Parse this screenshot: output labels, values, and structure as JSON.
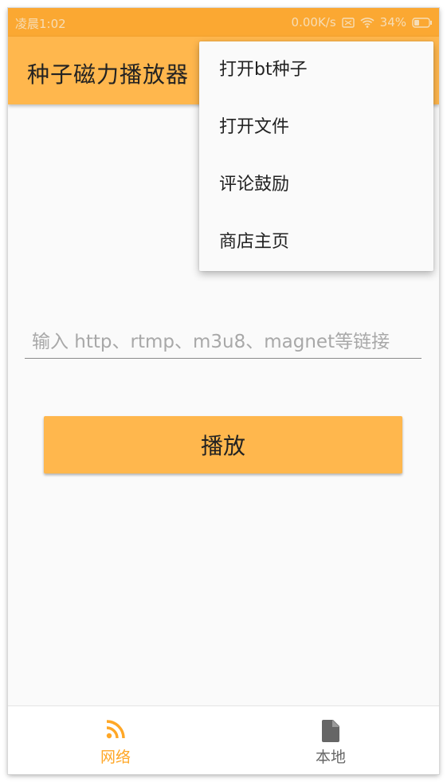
{
  "status_bar": {
    "time": "凌晨1:02",
    "net_speed": "0.00K/s",
    "battery": "34%",
    "icons": [
      "notification-icon",
      "wifi-icon",
      "battery-icon"
    ]
  },
  "app_bar": {
    "title": "种子磁力播放器"
  },
  "overflow_menu": {
    "items": [
      {
        "label": "打开bt种子"
      },
      {
        "label": "打开文件"
      },
      {
        "label": "评论鼓励"
      },
      {
        "label": "商店主页"
      }
    ]
  },
  "url_input": {
    "placeholder": "输入 http、rtmp、m3u8、magnet等链接",
    "value": ""
  },
  "play_button": {
    "label": "播放"
  },
  "bottom_nav": {
    "items": [
      {
        "label": "网络",
        "icon": "rss-icon",
        "active": true
      },
      {
        "label": "本地",
        "icon": "file-icon",
        "active": false
      }
    ]
  },
  "colors": {
    "status_bar": "#fba832",
    "accent": "#ffb74d",
    "active_nav": "#ffa726",
    "inactive_nav": "#666666"
  }
}
